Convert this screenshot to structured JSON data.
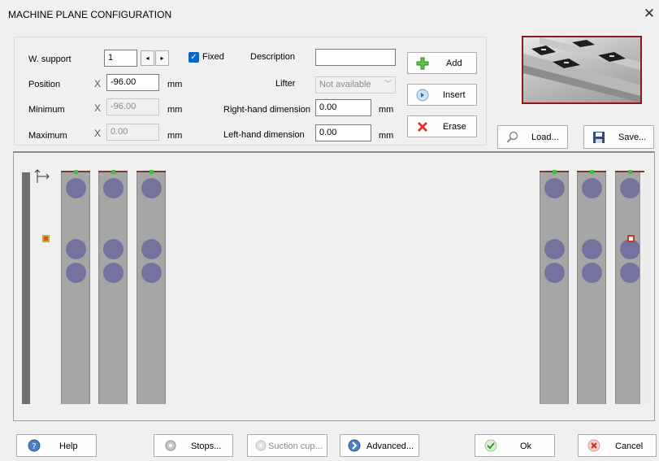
{
  "window": {
    "title": "MACHINE PLANE CONFIGURATION",
    "close_glyph": "✕"
  },
  "form": {
    "w_support_label": "W. support",
    "w_support_value": "1",
    "spin_prev": "◂",
    "spin_next": "▸",
    "fixed_label": "Fixed",
    "fixed_checked": true,
    "description_label": "Description",
    "description_value": "",
    "position_label": "Position",
    "position_x": "X",
    "position_value": "-96.00",
    "position_unit": "mm",
    "minimum_label": "Minimum",
    "minimum_x": "X",
    "minimum_value": "-96.00",
    "minimum_unit": "mm",
    "maximum_label": "Maximum",
    "maximum_x": "X",
    "maximum_value": "0.00",
    "maximum_unit": "mm",
    "lifter_label": "Lifter",
    "lifter_value": "Not available",
    "right_dim_label": "Right-hand dimension",
    "right_dim_value": "0.00",
    "right_dim_unit": "mm",
    "left_dim_label": "Left-hand dimension",
    "left_dim_value": "0.00",
    "left_dim_unit": "mm"
  },
  "actions": {
    "add": "Add",
    "insert": "Insert",
    "erase": "Erase",
    "load": "Load...",
    "save": "Save..."
  },
  "footer": {
    "help": "Help",
    "stops": "Stops...",
    "suction_cup": "Suction cup...",
    "advanced": "Advanced...",
    "ok": "Ok",
    "cancel": "Cancel"
  },
  "icons": {
    "add": "green-plus-icon",
    "insert": "insert-arrow-icon",
    "erase": "red-x-icon",
    "load": "magnifier-icon",
    "save": "floppy-disk-icon",
    "help": "question-icon",
    "stops": "gear-icon",
    "suction_cup": "gear-icon",
    "advanced": "blue-arrow-icon",
    "ok": "green-check-icon",
    "cancel": "red-cancel-icon",
    "origin": "origin-axes-icon"
  },
  "colors": {
    "support_bar": "#a6a6a6",
    "suction_cup": "#7473a0",
    "top_indicator": "#2ad02a",
    "thumbnail_border": "#8b1b1b",
    "check_blue": "#0a66c8"
  }
}
